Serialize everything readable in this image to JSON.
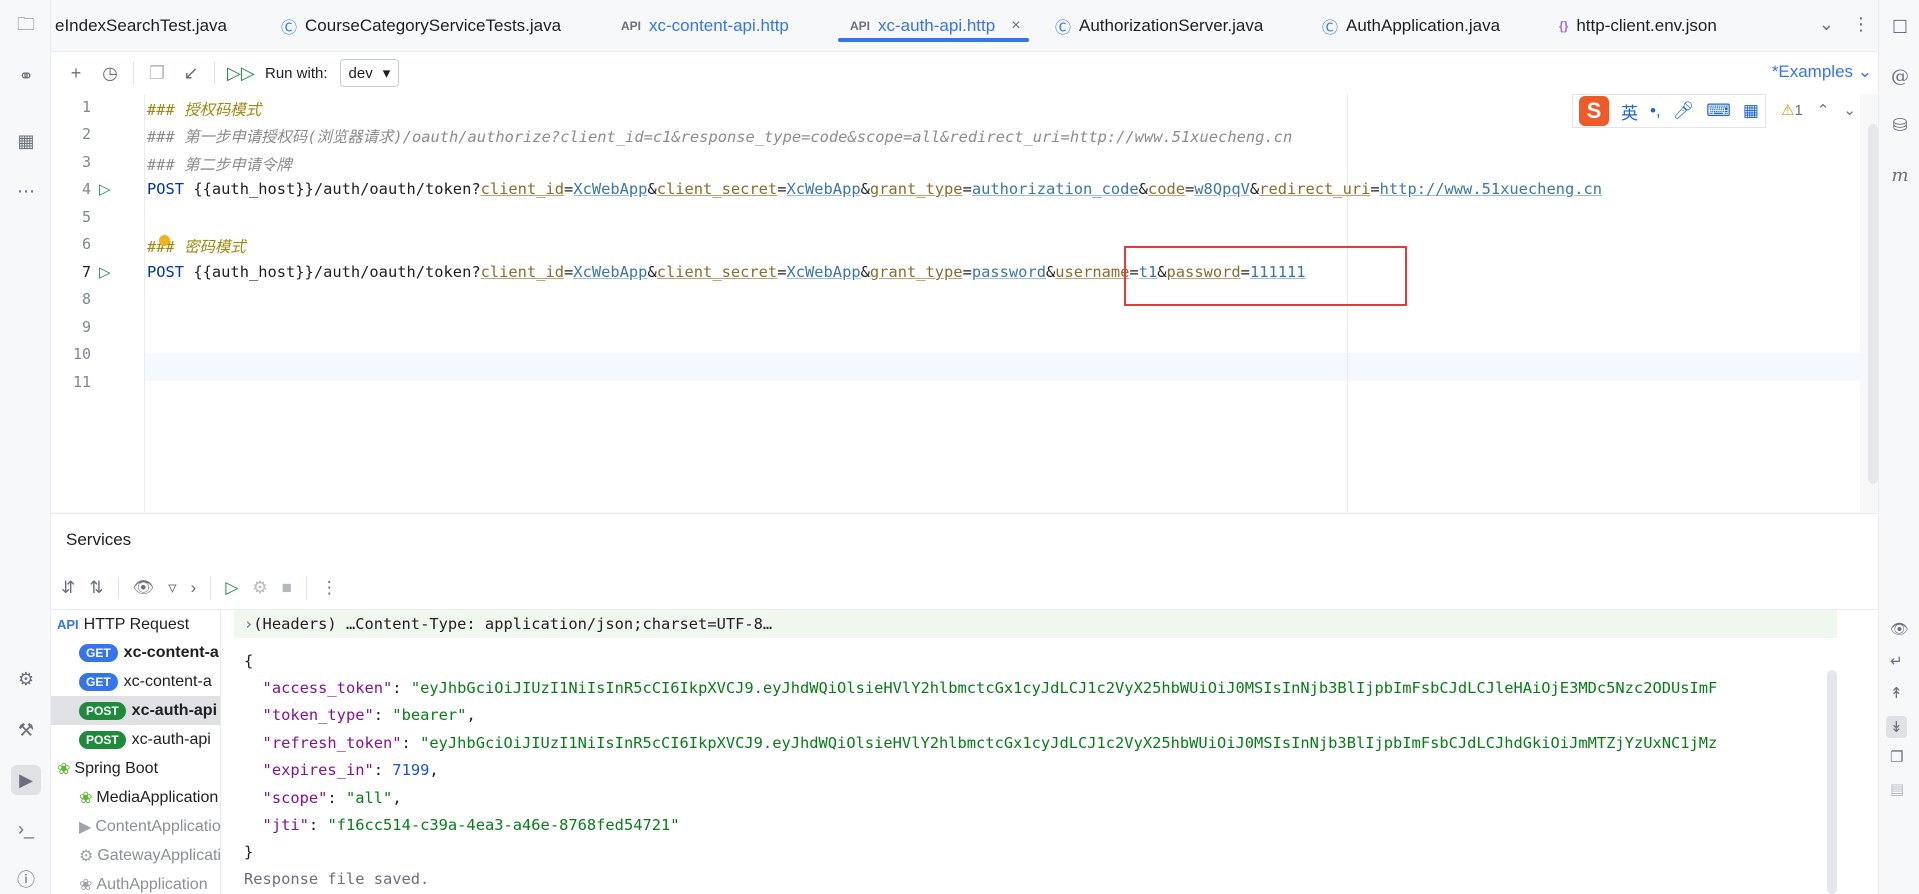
{
  "tabs": [
    {
      "label": "eIndexSearchTest.java",
      "icon": "class-icon",
      "kind": "java"
    },
    {
      "label": "CourseCategoryServiceTests.java",
      "icon": "class-icon",
      "kind": "java"
    },
    {
      "label": "xc-content-api.http",
      "icon": "api-icon",
      "kind": "http",
      "icon_text": "API"
    },
    {
      "label": "xc-auth-api.http",
      "icon": "api-icon",
      "kind": "http",
      "icon_text": "API",
      "active": true,
      "close": "×"
    },
    {
      "label": "AuthorizationServer.java",
      "icon": "class-icon",
      "kind": "java"
    },
    {
      "label": "AuthApplication.java",
      "icon": "spring-class-icon",
      "kind": "java"
    },
    {
      "label": "http-client.env.json",
      "icon": "json-icon",
      "kind": "json",
      "icon_text": "{}"
    }
  ],
  "toolbar": {
    "run_with_label": "Run with:",
    "env_value": "dev",
    "examples_label": "*Examples"
  },
  "editor": {
    "line_numbers": [
      "1",
      "2",
      "3",
      "4",
      "5",
      "6",
      "7",
      "8",
      "9",
      "10",
      "11"
    ],
    "line1": "### 授权码模式",
    "line2": "### 第一步申请授权码(浏览器请求)/oauth/authorize?client_id=c1&response_type=code&scope=all&redirect_uri=http://www.51xuecheng.cn",
    "line3": "### 第二步申请令牌",
    "line4": {
      "method": "POST",
      "path": "{{auth_host}}/auth/oauth/token?",
      "params": [
        {
          "name": "client_id",
          "value": "XcWebApp"
        },
        {
          "name": "client_secret",
          "value": "XcWebApp"
        },
        {
          "name": "grant_type",
          "value": "authorization_code"
        },
        {
          "name": "code",
          "value": "w8QpqV"
        },
        {
          "name": "redirect_uri",
          "value": "http://www.51xuecheng.cn"
        }
      ]
    },
    "line6_hash": "###",
    "line6_text": "密码模式",
    "line7": {
      "method": "POST",
      "path": "{{auth_host}}/auth/oauth/token?",
      "params": [
        {
          "name": "client_id",
          "value": "XcWebApp"
        },
        {
          "name": "client_secret",
          "value": "XcWebApp"
        },
        {
          "name": "grant_type",
          "value": "password"
        },
        {
          "name": "username",
          "value": "t1"
        },
        {
          "name": "password",
          "value": "111111"
        }
      ]
    },
    "warning_count": "1"
  },
  "ime": {
    "mode_label": "英",
    "punct": "•,"
  },
  "services": {
    "title": "Services",
    "tree": [
      {
        "label": "HTTP Request",
        "type": "group",
        "icon_text": "API"
      },
      {
        "label": "xc-content-a",
        "badge": "GET",
        "bold": true
      },
      {
        "label": "xc-content-a",
        "badge": "GET"
      },
      {
        "label": "xc-auth-api",
        "badge": "POST",
        "bold": true,
        "selected": true
      },
      {
        "label": "xc-auth-api",
        "badge": "POST"
      },
      {
        "label": "Spring Boot",
        "type": "group"
      },
      {
        "label": "MediaApplication",
        "state": "running"
      },
      {
        "label": "ContentApplication",
        "state": "stopped"
      },
      {
        "label": "GatewayApplication",
        "state": "stopped"
      },
      {
        "label": "AuthApplication",
        "state": "stopped"
      }
    ],
    "output": {
      "headers": "(Headers) …Content-Type: application/json;charset=UTF-8…",
      "open_brace": "{",
      "close_brace": "}",
      "fields": [
        {
          "key": "\"access_token\"",
          "value": "\"eyJhbGciOiJIUzI1NiIsInR5cCI6IkpXVCJ9.eyJhdWQiOlsieHVlY2hlbmctcGx1cyJdLCJ1c2VyX25hbWUiOiJ0MSIsInNjb3BlIjpbImFsbCJdLCJleHAiOjE3MDc5Nzc2ODUsImF",
          "type": "string"
        },
        {
          "key": "\"token_type\"",
          "value": "\"bearer\"",
          "type": "string"
        },
        {
          "key": "\"refresh_token\"",
          "value": "\"eyJhbGciOiJIUzI1NiIsInR5cCI6IkpXVCJ9.eyJhdWQiOlsieHVlY2hlbmctcGx1cyJdLCJ1c2VyX25hbWUiOiJ0MSIsInNjb3BlIjpbImFsbCJdLCJhdGkiOiJmMTZjYzUxNC1jMz",
          "type": "string"
        },
        {
          "key": "\"expires_in\"",
          "value": "7199",
          "type": "number"
        },
        {
          "key": "\"scope\"",
          "value": "\"all\"",
          "type": "string"
        },
        {
          "key": "\"jti\"",
          "value": "\"f16cc514-c39a-4ea3-a46e-8768fed54721\"",
          "type": "string",
          "last": true
        }
      ],
      "footer": "Response file saved."
    }
  }
}
